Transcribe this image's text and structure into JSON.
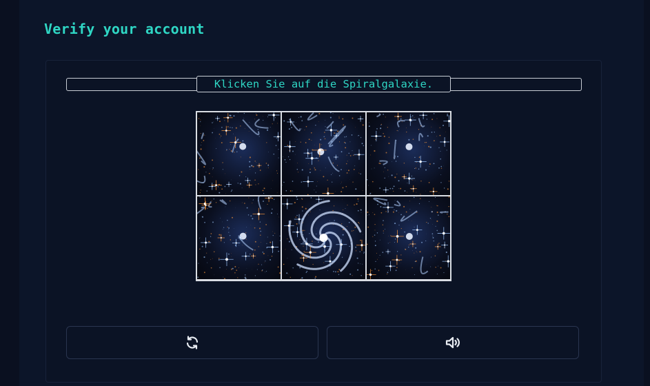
{
  "title": "Verify your account",
  "captcha": {
    "instruction": "Klicken Sie auf die Spiralgalaxie.",
    "tiles": [
      {
        "name": "galaxy-tile-1",
        "kind": "cluster",
        "hue": "orange"
      },
      {
        "name": "galaxy-tile-2",
        "kind": "cluster",
        "hue": "blue"
      },
      {
        "name": "galaxy-tile-3",
        "kind": "cluster",
        "hue": "blue"
      },
      {
        "name": "galaxy-tile-4",
        "kind": "cluster",
        "hue": "orange"
      },
      {
        "name": "galaxy-tile-5",
        "kind": "spiral",
        "hue": "blue"
      },
      {
        "name": "galaxy-tile-6",
        "kind": "cluster",
        "hue": "orange"
      }
    ]
  },
  "buttons": {
    "refresh_icon": "refresh-icon",
    "audio_icon": "speaker-icon"
  },
  "colors": {
    "accent": "#2fd6c4",
    "background": "#0b1426",
    "star_blue": "#9fc8ff",
    "star_orange": "#ff9a3c"
  }
}
